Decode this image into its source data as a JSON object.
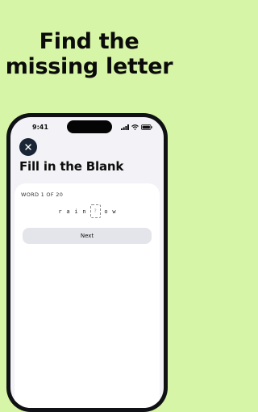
{
  "headline": {
    "line1": "Find the",
    "line2": "missing letter"
  },
  "status_bar": {
    "time": "9:41",
    "icons": [
      "signal-icon",
      "wifi-icon",
      "battery-icon"
    ]
  },
  "close_button": {
    "icon": "close-icon"
  },
  "screen_title": "Fill in the Blank",
  "card": {
    "counter": "WORD 1 OF 20",
    "letters_before": [
      "r",
      "a",
      "i",
      "n"
    ],
    "blank_placeholder": "?",
    "letters_after": [
      "o",
      "w"
    ],
    "next_label": "Next"
  },
  "colors": {
    "background": "#D7F5A6",
    "phone_frame": "#101114",
    "screen_bg": "#F2F2F7",
    "close_button_bg": "#1a2535",
    "next_button_bg": "#E3E5EA"
  }
}
